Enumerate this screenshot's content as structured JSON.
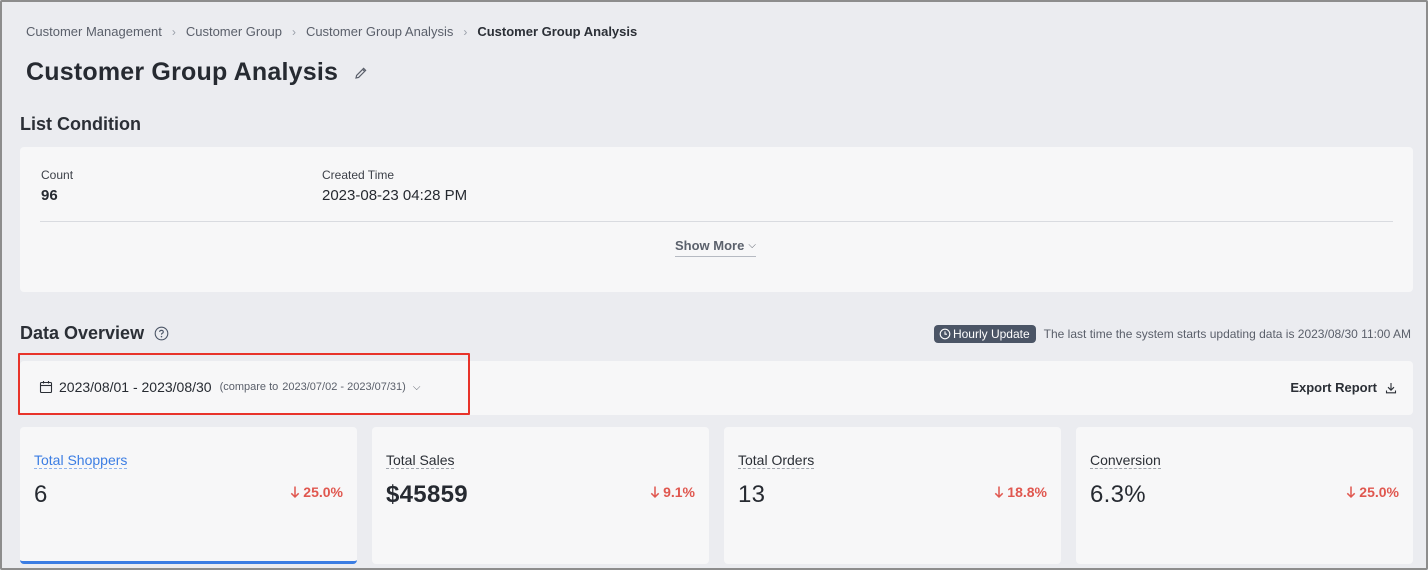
{
  "breadcrumb": {
    "items": [
      "Customer Management",
      "Customer Group",
      "Customer Group Analysis"
    ],
    "current": "Customer Group Analysis"
  },
  "page": {
    "title": "Customer Group Analysis"
  },
  "list_condition": {
    "title": "List Condition",
    "count_label": "Count",
    "count_value": "96",
    "created_label": "Created Time",
    "created_value": "2023-08-23 04:28 PM",
    "show_more": "Show More"
  },
  "data_overview": {
    "title": "Data Overview",
    "hourly_badge": "Hourly Update",
    "update_text": "The last time the system starts updating data is 2023/08/30 11:00 AM",
    "date_range": "2023/08/01 - 2023/08/30",
    "compare_label": "(compare to",
    "compare_range": "2023/07/02 - 2023/07/31)",
    "export_label": "Export Report"
  },
  "metrics": [
    {
      "label": "Total Shoppers",
      "value": "6",
      "change": "25.0%",
      "direction": "down",
      "active": true
    },
    {
      "label": "Total Sales",
      "value": "$45859",
      "change": "9.1%",
      "direction": "down",
      "active": false
    },
    {
      "label": "Total Orders",
      "value": "13",
      "change": "18.8%",
      "direction": "down",
      "active": false
    },
    {
      "label": "Conversion",
      "value": "6.3%",
      "change": "25.0%",
      "direction": "down",
      "active": false
    }
  ],
  "colors": {
    "accent": "#3b7de3",
    "negative": "#e0574f",
    "highlight": "#e8332a",
    "badge": "#4b5566"
  }
}
